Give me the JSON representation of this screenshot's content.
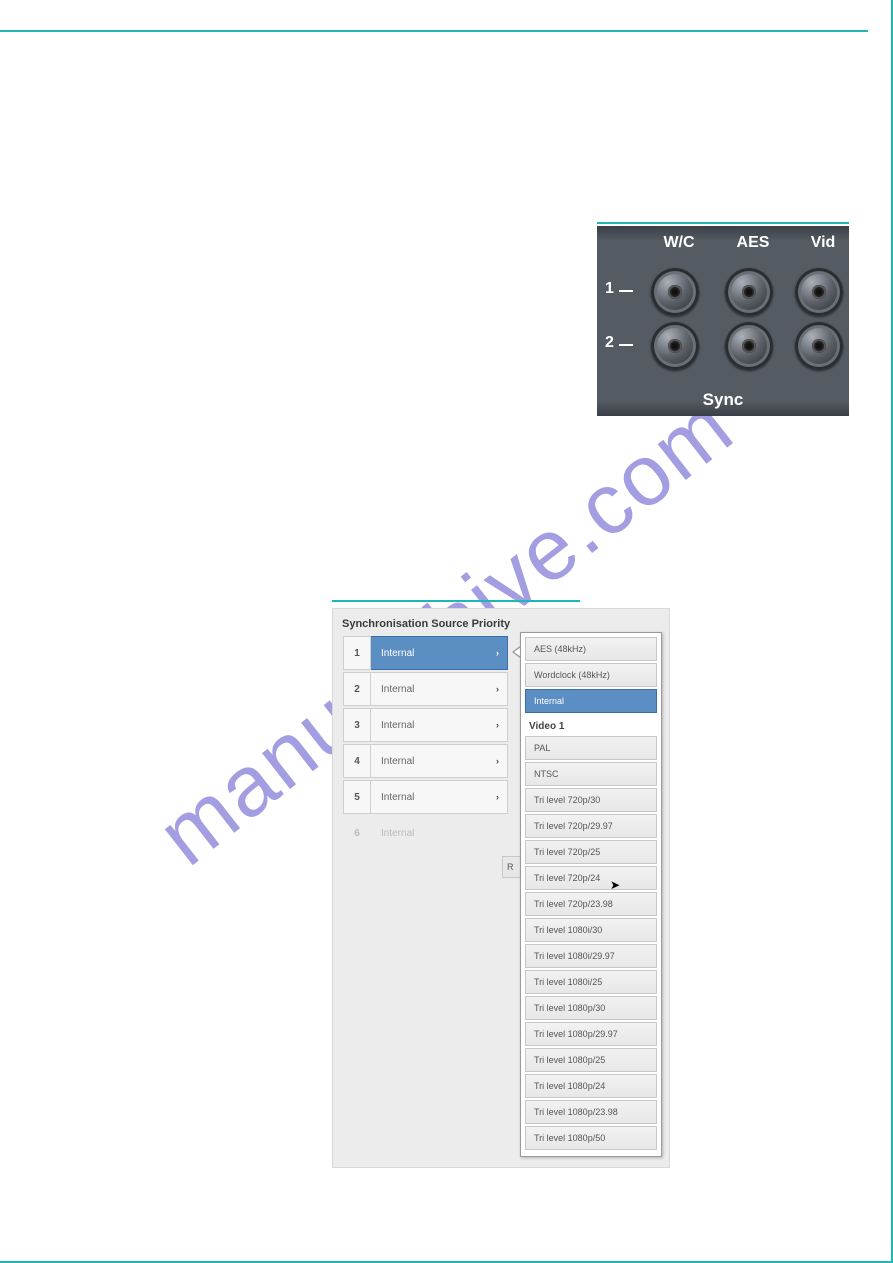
{
  "watermark": "manualshive.com",
  "hardware_panel": {
    "col_labels": {
      "wc": "W/C",
      "aes": "AES",
      "vid": "Vid"
    },
    "row_labels": {
      "r1": "1",
      "r2": "2"
    },
    "bottom_label": "Sync"
  },
  "screenshot": {
    "title": "Synchronisation Source Priority",
    "priority_rows": [
      {
        "num": "1",
        "value": "Internal",
        "selected": true
      },
      {
        "num": "2",
        "value": "Internal",
        "selected": false
      },
      {
        "num": "3",
        "value": "Internal",
        "selected": false
      },
      {
        "num": "4",
        "value": "Internal",
        "selected": false
      },
      {
        "num": "5",
        "value": "Internal",
        "selected": false
      },
      {
        "num": "6",
        "value": "Internal",
        "selected": false,
        "disabled": true
      }
    ],
    "reset_fragment": "R",
    "flyout": {
      "top_items": [
        {
          "label": "AES (48kHz)",
          "selected": false
        },
        {
          "label": "Wordclock (48kHz)",
          "selected": false
        },
        {
          "label": "Internal",
          "selected": true
        }
      ],
      "section_label": "Video 1",
      "video_items": [
        "PAL",
        "NTSC",
        "Tri level 720p/30",
        "Tri level 720p/29.97",
        "Tri level 720p/25",
        "Tri level 720p/24",
        "Tri level 720p/23.98",
        "Tri level 1080i/30",
        "Tri level 1080i/29.97",
        "Tri level 1080i/25",
        "Tri level 1080p/30",
        "Tri level 1080p/29.97",
        "Tri level 1080p/25",
        "Tri level 1080p/24",
        "Tri level 1080p/23.98",
        "Tri level 1080p/50"
      ]
    }
  }
}
